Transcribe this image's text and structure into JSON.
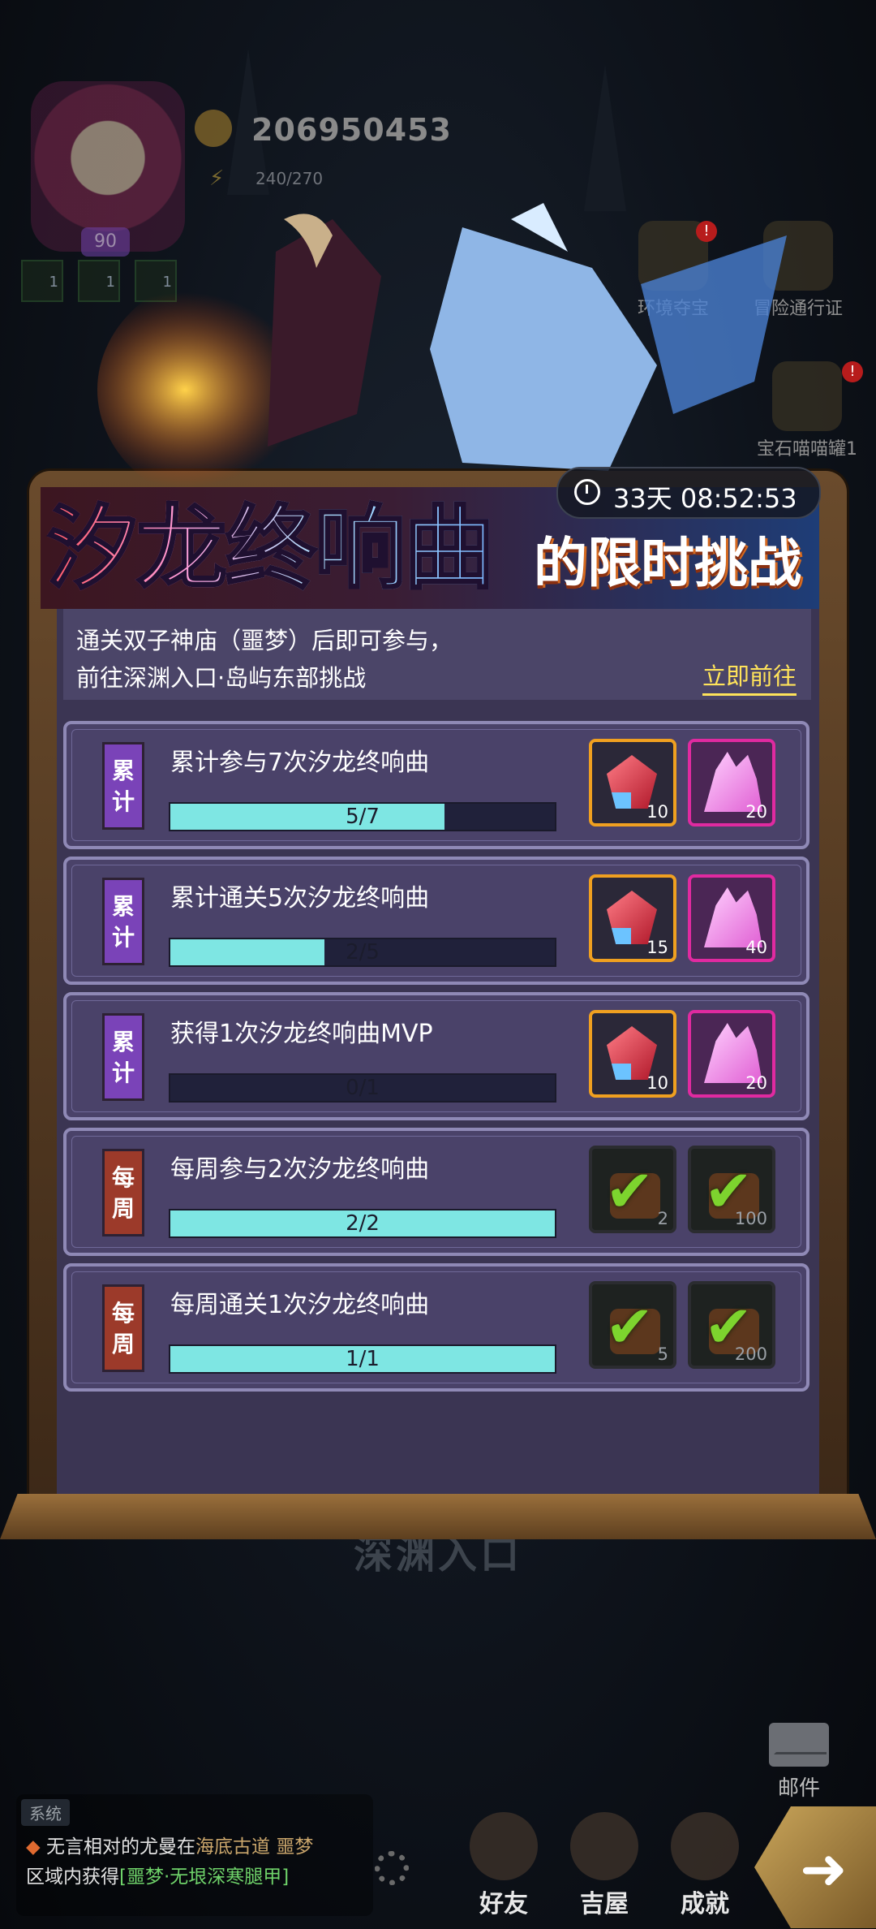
{
  "player": {
    "level": "90",
    "currency_value": "206950453",
    "energy": "240/270",
    "stats": [
      "1",
      "1",
      "1"
    ]
  },
  "side_events": [
    "环境夺宝",
    "冒险通行证",
    "宝石喵喵罐1"
  ],
  "side_badges": [
    "!",
    "!"
  ],
  "event": {
    "title": "汐龙终响曲",
    "subtitle": "的限时挑战",
    "timer": "33天 08:52:53",
    "desc_line1": "通关双子神庙（噩梦）后即可参与，",
    "desc_line2": "前往深渊入口·岛屿东部挑战",
    "go_label": "立即前往"
  },
  "tasks": [
    {
      "tag": "累计",
      "name": "累计参与7次汐龙终响曲",
      "progress": "5/7",
      "fraction": 0.714,
      "rewards": [
        {
          "type": "red-crystal",
          "qty": "10"
        },
        {
          "type": "pink-crystal",
          "qty": "20"
        }
      ]
    },
    {
      "tag": "累计",
      "name": "累计通关5次汐龙终响曲",
      "progress": "2/5",
      "fraction": 0.4,
      "rewards": [
        {
          "type": "red-crystal",
          "qty": "15"
        },
        {
          "type": "pink-crystal",
          "qty": "40"
        }
      ]
    },
    {
      "tag": "累计",
      "name": "获得1次汐龙终响曲MVP",
      "progress": "0/1",
      "fraction": 0,
      "rewards": [
        {
          "type": "red-crystal",
          "qty": "10"
        },
        {
          "type": "pink-crystal",
          "qty": "20"
        }
      ]
    },
    {
      "tag": "每周",
      "name": "每周参与2次汐龙终响曲",
      "progress": "2/2",
      "fraction": 1,
      "rewards": [
        {
          "type": "claimed",
          "qty": "2"
        },
        {
          "type": "claimed",
          "qty": "100"
        }
      ]
    },
    {
      "tag": "每周",
      "name": "每周通关1次汐龙终响曲",
      "progress": "1/1",
      "fraction": 1,
      "rewards": [
        {
          "type": "claimed",
          "qty": "5"
        },
        {
          "type": "claimed",
          "qty": "200"
        }
      ]
    }
  ],
  "area_name": "深渊入口",
  "mail_label": "邮件",
  "chat": {
    "tag": "系统",
    "line1_prefix": "无言相对的尤曼在",
    "line1_loc": "海底古道 噩梦",
    "line2_prefix": "区域内获得",
    "line2_item": "[噩梦·无垠深寒腿甲]"
  },
  "bottom_nav": [
    "好友",
    "吉屋",
    "成就"
  ],
  "colors": {
    "progress_fill": "#7ee6e3",
    "cumulative_tag": "#7a43b8",
    "weekly_tag": "#9c3a2a",
    "link": "#ffe35a"
  }
}
